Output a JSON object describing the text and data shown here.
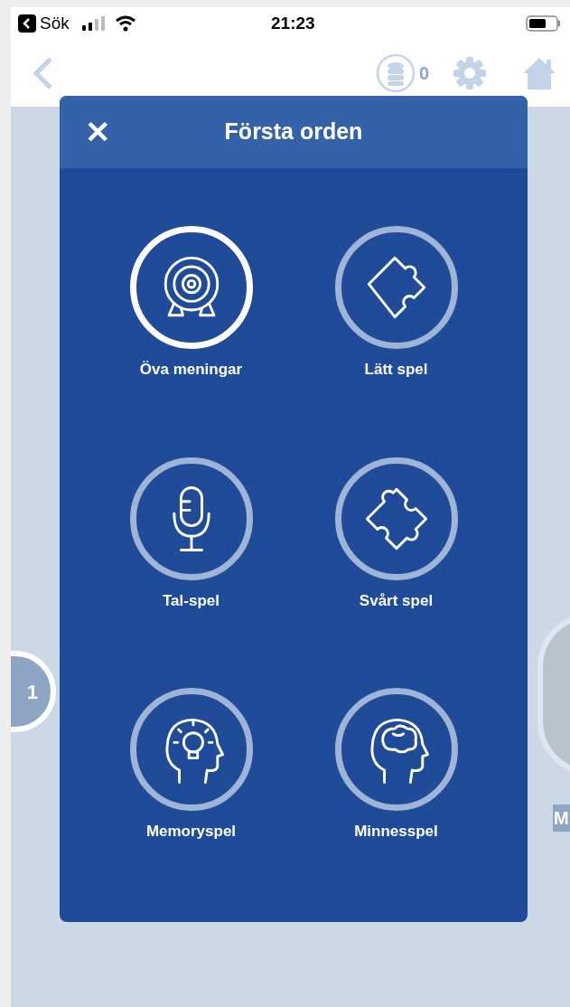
{
  "status_bar": {
    "back_label": "Sök",
    "time": "21:23"
  },
  "nav_bar": {
    "coins": "0"
  },
  "background": {
    "level_number": "1",
    "partial_label": "M"
  },
  "dialog": {
    "title": "Första orden",
    "close": "✕",
    "games": [
      {
        "label": "Öva meningar",
        "kind": "target",
        "selected": true
      },
      {
        "label": "Lätt spel",
        "kind": "puzzle-easy",
        "selected": false
      },
      {
        "label": "Tal-spel",
        "kind": "microphone",
        "selected": false
      },
      {
        "label": "Svårt spel",
        "kind": "puzzle-hard",
        "selected": false
      },
      {
        "label": "Memoryspel",
        "kind": "head-bulb",
        "selected": false
      },
      {
        "label": "Minnesspel",
        "kind": "head-brain",
        "selected": false
      }
    ]
  }
}
